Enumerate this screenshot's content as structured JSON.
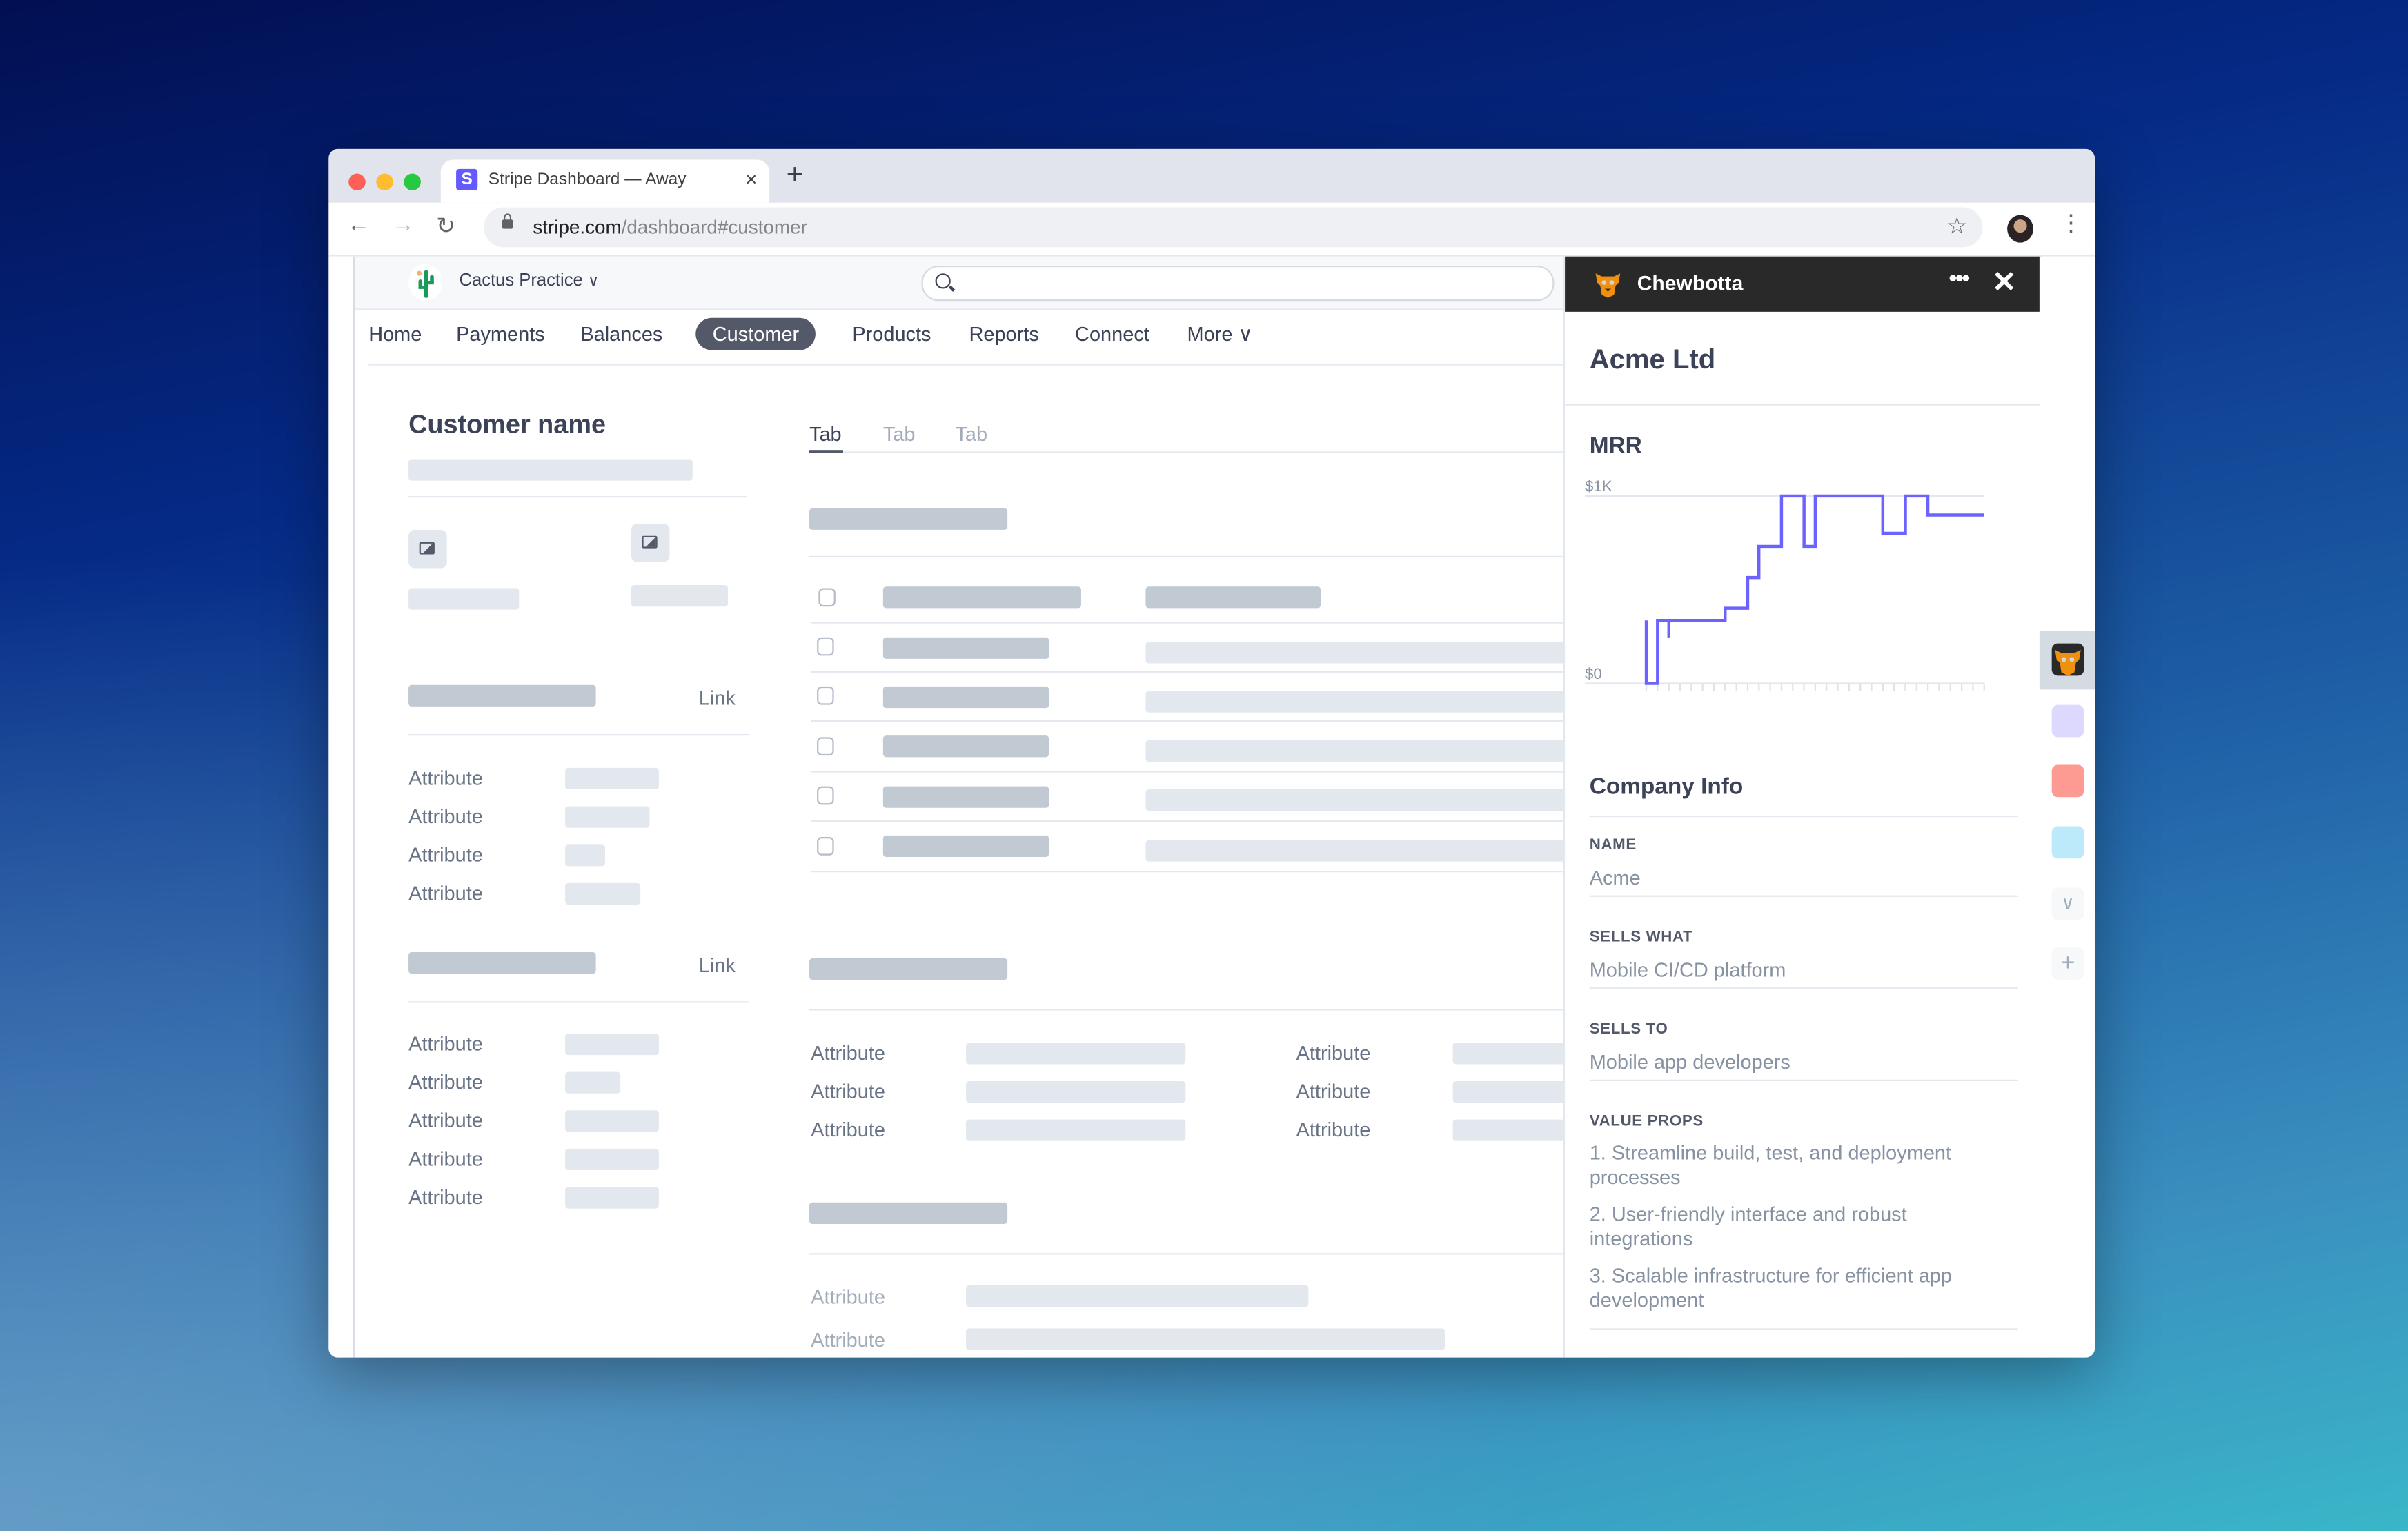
{
  "browser": {
    "tab_title": "Stripe Dashboard — Away",
    "tab_favicon_letter": "S",
    "tab_close": "×",
    "new_tab": "+",
    "url_host": "stripe.com",
    "url_path": "/dashboard#customer",
    "back": "←",
    "forward": "→",
    "reload": "↻",
    "bookmark": "☆",
    "menu": "⋮"
  },
  "dashboard": {
    "account_name": "Cactus Practice",
    "account_chevron": "∨",
    "search_placeholder": "",
    "nav": [
      {
        "label": "Home"
      },
      {
        "label": "Payments"
      },
      {
        "label": "Balances"
      },
      {
        "label": "Customer",
        "active": true
      },
      {
        "label": "Products"
      },
      {
        "label": "Reports"
      },
      {
        "label": "Connect"
      },
      {
        "label": "More ∨"
      }
    ],
    "customer_title": "Customer name",
    "links": [
      "Link",
      "Link"
    ],
    "attribute_label": "Attribute",
    "tabs": [
      "Tab",
      "Tab",
      "Tab"
    ]
  },
  "panel": {
    "app_name": "Chewbotta",
    "more_label": "•••",
    "close_label": "✕",
    "company": "Acme Ltd",
    "mrr_title": "MRR",
    "company_info_title": "Company Info",
    "fields": [
      {
        "label": "NAME",
        "value": "Acme"
      },
      {
        "label": "SELLS WHAT",
        "value": "Mobile CI/CD platform"
      },
      {
        "label": "SELLS TO",
        "value": "Mobile app developers"
      }
    ],
    "value_props_label": "VALUE PROPS",
    "value_props": [
      "1. Streamline build, test, and deployment processes",
      "2. User-friendly interface and robust integrations",
      "3. Scalable infrastructure for efficient app development"
    ]
  },
  "rail": {
    "app_colors": [
      "#292929",
      "#ddd8fd",
      "#fd9a91",
      "#bdeafb"
    ],
    "expand_label": "∨",
    "add_label": "+"
  },
  "colors": {
    "accent": "#635bff",
    "chart_line": "#6c63ff",
    "active_nav": "#545969"
  },
  "chart_data": {
    "type": "line",
    "title": "MRR",
    "step": true,
    "ytick_labels": [
      "$0",
      "$1K"
    ],
    "ylim": [
      0,
      1000
    ],
    "x_count": 30,
    "points": [
      [
        0,
        336
      ],
      [
        0,
        0
      ],
      [
        1,
        0
      ],
      [
        1,
        336
      ],
      [
        2,
        336
      ],
      [
        2,
        245
      ],
      [
        2,
        336
      ],
      [
        7,
        336
      ],
      [
        7,
        401
      ],
      [
        9,
        401
      ],
      [
        9,
        565
      ],
      [
        10,
        565
      ],
      [
        10,
        731
      ],
      [
        12,
        731
      ],
      [
        12,
        1000
      ],
      [
        14,
        1000
      ],
      [
        14,
        731
      ],
      [
        15,
        731
      ],
      [
        15,
        1000
      ],
      [
        21,
        1000
      ],
      [
        21,
        801
      ],
      [
        23,
        801
      ],
      [
        23,
        1000
      ],
      [
        25,
        1000
      ],
      [
        25,
        898
      ],
      [
        30,
        898
      ]
    ],
    "grid": true
  }
}
